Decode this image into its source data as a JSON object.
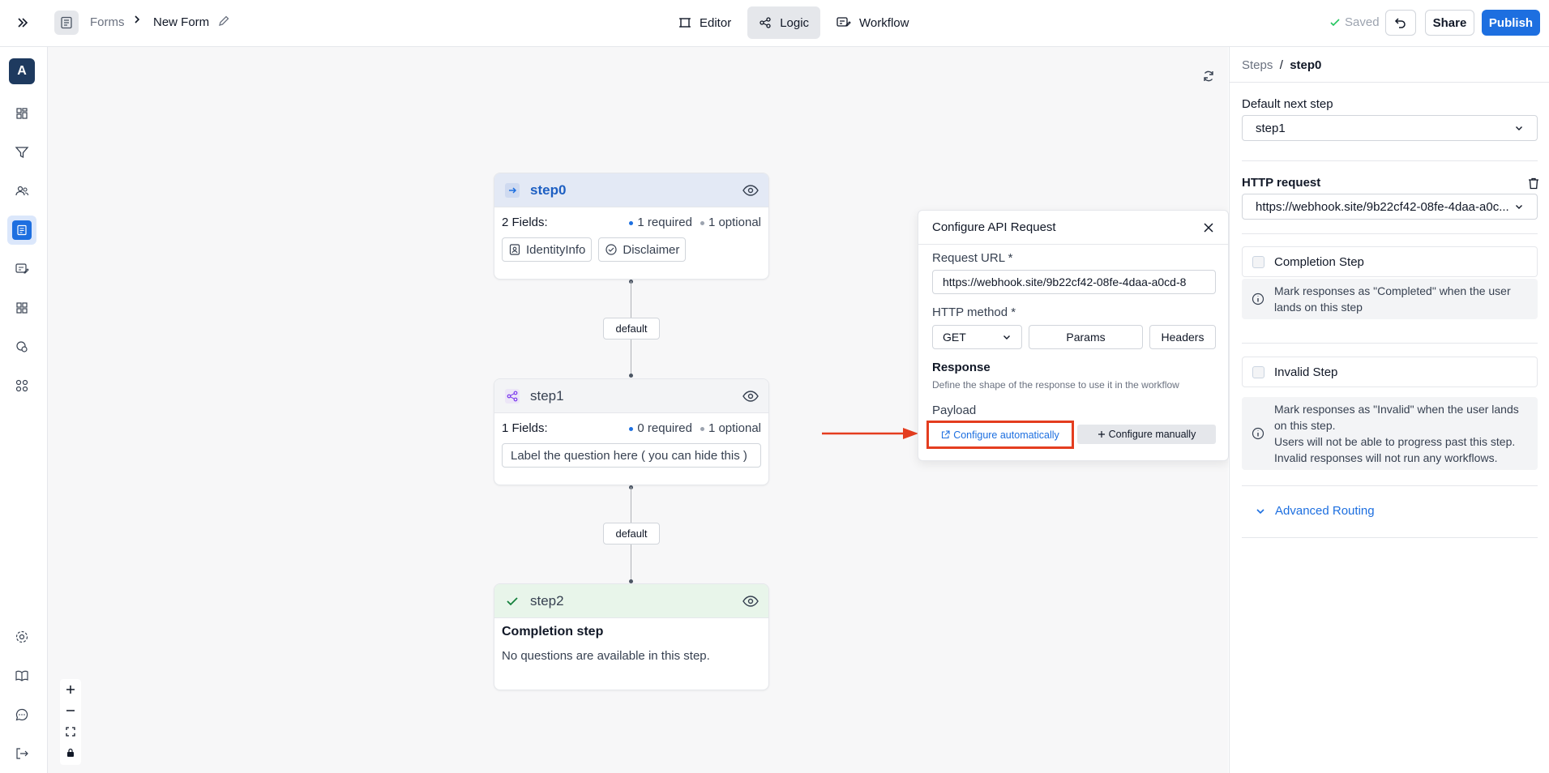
{
  "header": {
    "breadcrumb_forms": "Forms",
    "form_name": "New Form",
    "tabs": [
      {
        "label": "Editor"
      },
      {
        "label": "Logic"
      },
      {
        "label": "Workflow"
      }
    ],
    "saved_label": "Saved",
    "share_label": "Share",
    "publish_label": "Publish"
  },
  "sidebar": {
    "avatar_letter": "A"
  },
  "nodes": {
    "step0": {
      "title": "step0",
      "fields_count": "2 Fields:",
      "required": "1 required",
      "optional": "1 optional",
      "chips": [
        "IdentityInfo",
        "Disclaimer"
      ]
    },
    "step1": {
      "title": "step1",
      "fields_count": "1 Fields:",
      "required": "0 required",
      "optional": "1 optional",
      "question": "Label the question here ( you can hide this )"
    },
    "step2": {
      "title": "step2",
      "heading": "Completion step",
      "message": "No questions are available in this step."
    },
    "edge_labels": [
      "default",
      "default"
    ]
  },
  "api_popover": {
    "title": "Configure API Request",
    "url_label": "Request URL *",
    "url_value": "https://webhook.site/9b22cf42-08fe-4daa-a0cd-8",
    "method_label": "HTTP method *",
    "method_value": "GET",
    "params_label": "Params",
    "headers_label": "Headers",
    "response_label": "Response",
    "response_desc": "Define the shape of the response to use it in the workflow",
    "payload_label": "Payload",
    "auto_label": "Configure automatically",
    "manual_label": "Configure manually"
  },
  "right_panel": {
    "crumb_root": "Steps",
    "crumb_sep": "/",
    "crumb_current": "step0",
    "default_next_label": "Default next step",
    "default_next_value": "step1",
    "http_request_label": "HTTP request",
    "http_request_value": "https://webhook.site/9b22cf42-08fe-4daa-a0c...",
    "completion_label": "Completion Step",
    "completion_info": "Mark responses as \"Completed\" when the user lands on this step",
    "invalid_label": "Invalid Step",
    "invalid_info_1": "Mark responses as \"Invalid\" when the user lands on this step.",
    "invalid_info_2": "Users will not be able to progress past this step.",
    "invalid_info_3": "Invalid responses will not run any workflows.",
    "advanced_label": "Advanced Routing"
  },
  "colors": {
    "primary": "#1d6fe0",
    "highlight_red": "#e43d1f",
    "step0_header": "#e3e9f5",
    "step2_header": "#e8f5ea"
  }
}
